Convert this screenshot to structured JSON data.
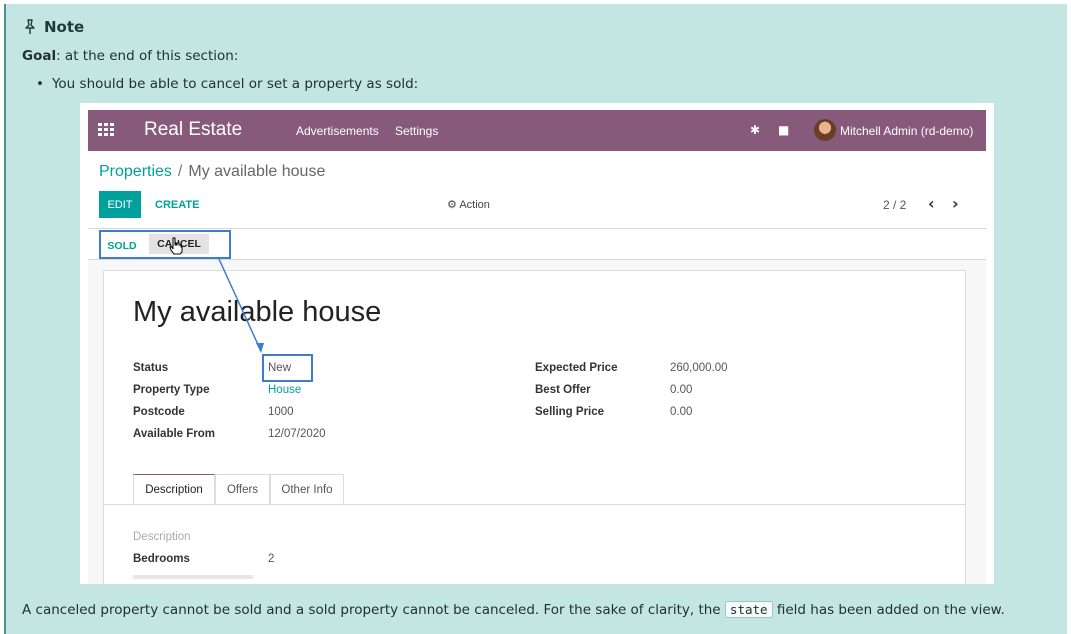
{
  "note": {
    "title": "Note",
    "goal_label": "Goal",
    "goal_text": ": at the end of this section:",
    "bullet": "You should be able to cancel or set a property as sold:",
    "footer_before": "A canceled property cannot be sold and a sold property cannot be canceled. For the sake of clarity, the",
    "footer_code": "state",
    "footer_after": "field has been added on the view."
  },
  "app": {
    "brand": "Real Estate",
    "menu": [
      "Advertisements",
      "Settings"
    ],
    "user": "Mitchell Admin (rd-demo)",
    "colors": {
      "navbar": "#875a7b",
      "primary": "#00a09d",
      "highlight": "#3d7ccf"
    }
  },
  "breadcrumb": {
    "parent": "Properties",
    "separator": "/",
    "current": "My available house"
  },
  "toolbar": {
    "edit": "EDIT",
    "create": "CREATE",
    "action": "Action",
    "pager": "2 / 2"
  },
  "statusbar": {
    "sold": "SOLD",
    "cancel": "CANCEL"
  },
  "record": {
    "title": "My available house",
    "left_fields": [
      {
        "label": "Status",
        "value": "New"
      },
      {
        "label": "Property Type",
        "value": "House"
      },
      {
        "label": "Postcode",
        "value": "1000"
      },
      {
        "label": "Available From",
        "value": "12/07/2020"
      }
    ],
    "right_fields": [
      {
        "label": "Expected Price",
        "value": "260,000.00"
      },
      {
        "label": "Best Offer",
        "value": "0.00"
      },
      {
        "label": "Selling Price",
        "value": "0.00"
      }
    ],
    "tabs": [
      "Description",
      "Offers",
      "Other Info"
    ],
    "description_placeholder": "Description",
    "bedrooms_label": "Bedrooms",
    "bedrooms_value": "2"
  }
}
